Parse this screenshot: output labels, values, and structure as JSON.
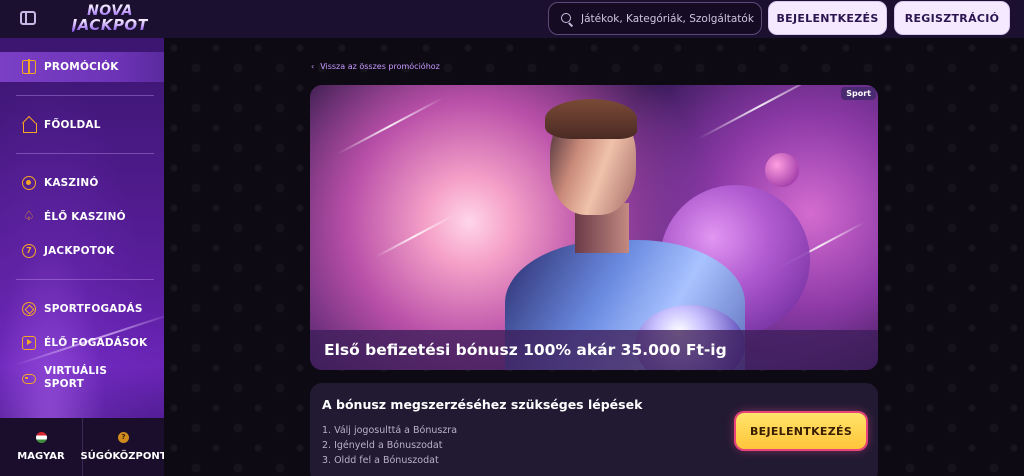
{
  "header": {
    "logo_line1": "NOVA",
    "logo_line2": "JACKPOT",
    "search_placeholder": "Játékok, Kategóriák, Szolgáltatók",
    "login_label": "BEJELENTKEZÉS",
    "register_label": "REGISZTRÁCIÓ"
  },
  "sidebar": {
    "items": [
      {
        "label": "PROMÓCIÓK",
        "icon": "gift-icon",
        "active": true
      },
      {
        "label": "FŐOLDAL",
        "icon": "home-icon"
      },
      {
        "label": "KASZINÓ",
        "icon": "casino-chip-icon"
      },
      {
        "label": "ÉLŐ KASZINÓ",
        "icon": "spade-icon"
      },
      {
        "label": "JACKPOTOK",
        "icon": "seven-icon"
      },
      {
        "label": "SPORTFOGADÁS",
        "icon": "soccer-ball-icon"
      },
      {
        "label": "ÉLŐ FOGADÁSOK",
        "icon": "play-icon"
      },
      {
        "label": "VIRTUÁLIS\nSPORT",
        "icon": "gamepad-icon"
      }
    ],
    "footer": {
      "language_label": "MAGYAR",
      "help_label": "SÚGÓKÖZPONT"
    }
  },
  "main": {
    "back_link": "Vissza az összes promócióhoz",
    "banner": {
      "tag": "Sport",
      "title": "Első befizetési bónusz 100% akár 35.000 Ft-ig"
    },
    "steps": {
      "title": "A bónusz megszerzéséhez szükséges lépések",
      "items": [
        "1. Válj jogosulttá a Bónuszra",
        "2. Igényeld a Bónuszodat",
        "3. Oldd fel a Bónuszodat"
      ],
      "cta_label": "BEJELENTKEZÉS"
    }
  },
  "colors": {
    "accent_orange": "#f5a623",
    "sidebar_purple": "#5a1e9c",
    "cta_yellow": "#ffc53a",
    "link_purple": "#c79bff"
  }
}
